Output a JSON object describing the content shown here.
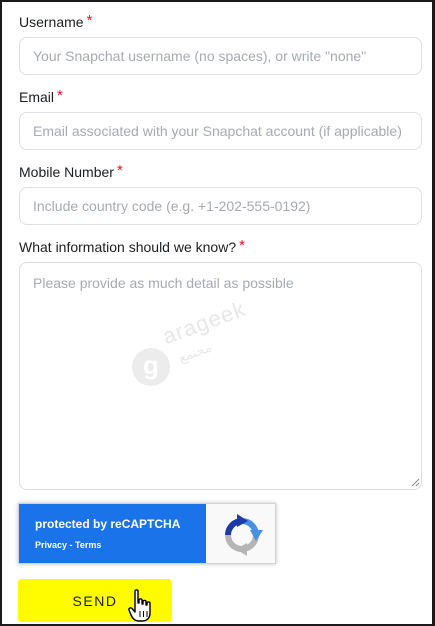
{
  "form": {
    "username": {
      "label": "Username",
      "required_mark": "*",
      "value": "",
      "placeholder": "Your Snapchat username (no spaces), or write \"none\""
    },
    "email": {
      "label": "Email",
      "required_mark": "*",
      "value": "",
      "placeholder": "Email associated with your Snapchat account (if applicable)"
    },
    "mobile": {
      "label": "Mobile Number",
      "required_mark": "*",
      "value": "",
      "placeholder": "Include country code (e.g. +1-202-555-0192)"
    },
    "details": {
      "label": "What information should we know?",
      "required_mark": "*",
      "value": "",
      "placeholder": "Please provide as much detail as possible"
    },
    "send_label": "SEND"
  },
  "recaptcha": {
    "title": "protected by reCAPTCHA",
    "links": "Privacy - Terms",
    "logo_icon": "recaptcha-logo-icon"
  },
  "watermark": {
    "letter": "g",
    "text": "arageek",
    "text_ar": "مجتمع"
  },
  "colors": {
    "required": "#e3132b",
    "send_button": "#fffc00",
    "recaptcha_blue": "#1a73e8",
    "input_border": "#dcdfe3",
    "placeholder": "#a6abb1"
  }
}
